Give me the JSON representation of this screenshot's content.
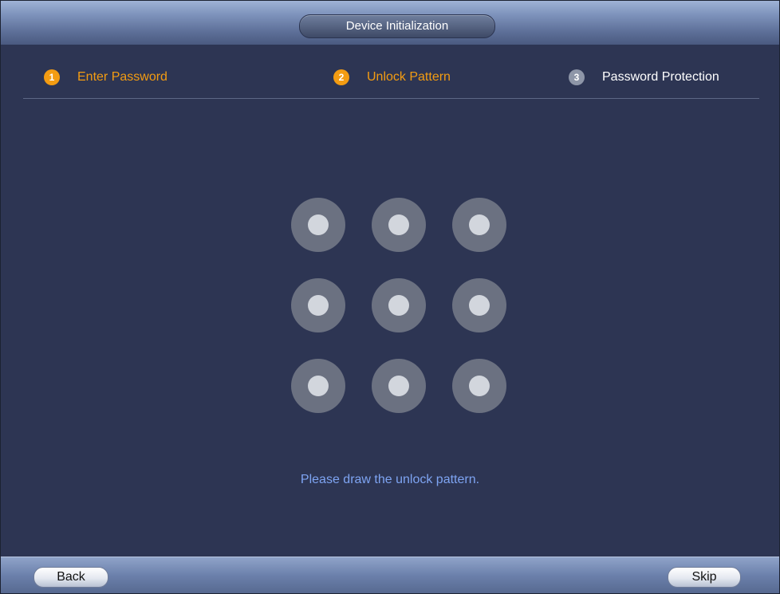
{
  "window": {
    "title": "Device Initialization"
  },
  "steps": [
    {
      "number": "1",
      "label": "Enter Password",
      "state": "active"
    },
    {
      "number": "2",
      "label": "Unlock Pattern",
      "state": "active"
    },
    {
      "number": "3",
      "label": "Password Protection",
      "state": "inactive"
    }
  ],
  "pattern": {
    "rows": 3,
    "cols": 3,
    "hint": "Please draw the unlock pattern."
  },
  "footer": {
    "back_label": "Back",
    "skip_label": "Skip"
  },
  "colors": {
    "background": "#2d3553",
    "active_step": "#f39c12",
    "hint_text": "#7ea4f2"
  }
}
